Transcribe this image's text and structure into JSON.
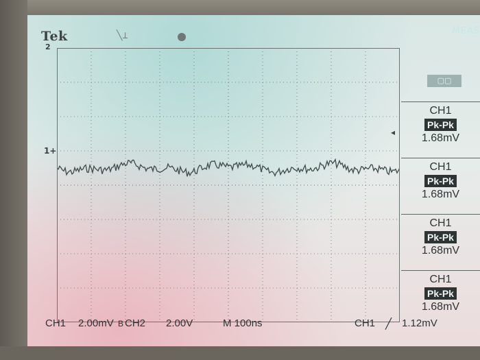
{
  "header": {
    "brand": "Tek",
    "menu": "MEAS"
  },
  "grid_markers": {
    "channel_ground": "1+",
    "channel_top": "2"
  },
  "measurements": [
    {
      "channel": "CH1",
      "type": "Pk-Pk",
      "value": "1.68mV"
    },
    {
      "channel": "CH1",
      "type": "Pk-Pk",
      "value": "1.68mV"
    },
    {
      "channel": "CH1",
      "type": "Pk-Pk",
      "value": "1.68mV"
    },
    {
      "channel": "CH1",
      "type": "Pk-Pk",
      "value": "1.68mV"
    }
  ],
  "status": {
    "ch1_label": "CH1",
    "ch1_scale": "2.00mV",
    "bw": "B",
    "ch2_label": "CH2",
    "ch2_scale": "2.00V",
    "timebase": "M 100ns",
    "trigger_source": "CH1",
    "trigger_level": "1.12mV"
  },
  "colors": {
    "trace": "#445150",
    "graticule": "#6a7372"
  }
}
